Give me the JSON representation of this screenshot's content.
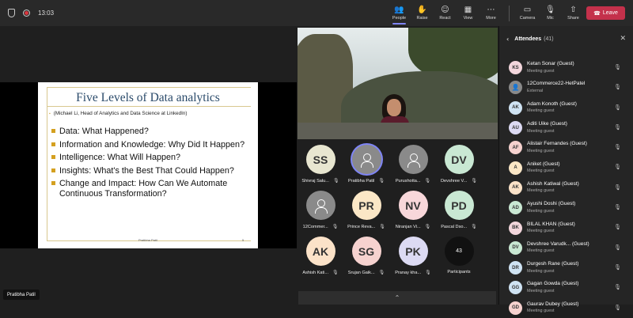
{
  "topbar": {
    "time": "13:03",
    "actions": [
      {
        "icon": "people-icon",
        "glyph": "👥",
        "label": "People",
        "active": true
      },
      {
        "icon": "raise-hand-icon",
        "glyph": "✋",
        "label": "Raise",
        "active": false
      },
      {
        "icon": "react-icon",
        "glyph": "☺",
        "label": "React",
        "active": false
      },
      {
        "icon": "view-icon",
        "glyph": "▦",
        "label": "View",
        "active": false
      },
      {
        "icon": "more-icon",
        "glyph": "⋯",
        "label": "More",
        "active": false
      }
    ],
    "devices": [
      {
        "icon": "camera-off-icon",
        "glyph": "▭",
        "label": "Camera"
      },
      {
        "icon": "mic-off-icon",
        "glyph": "🎙",
        "label": "Mic"
      },
      {
        "icon": "share-icon",
        "glyph": "⇧",
        "label": "Share"
      }
    ],
    "leave_label": "Leave",
    "leave_color": "#c4314b"
  },
  "slide": {
    "title": "Five Levels of Data analytics",
    "subtitle": "(Michael Li, Head of Analytics and Data Science at LinkedIn)",
    "bullets": [
      "Data: What Happened?",
      "Information and Knowledge: Why Did It Happen?",
      "Intelligence: What Will Happen?",
      "Insights: What's the Best That Could Happen?",
      "Change and Impact: How Can We Automate Continuous Transformation?"
    ],
    "footer_name": "Pratibha Patil",
    "footer_page": "5"
  },
  "presenter_name": "Pratibha Patil",
  "tiles": [
    {
      "initials": "SS",
      "name": "Shivraj Salu...",
      "color": "#e8e6d0",
      "type": "initials"
    },
    {
      "initials": "",
      "name": "Pratibha Patil",
      "color": "#8a8a8a",
      "type": "person",
      "speaking": true
    },
    {
      "initials": "",
      "name": "Purushotta...",
      "color": "#8a8a8a",
      "type": "person"
    },
    {
      "initials": "DV",
      "name": "Devshree V...",
      "color": "#c9e8d3",
      "type": "initials"
    },
    {
      "initials": "",
      "name": "12Commer...",
      "color": "#8a8a8a",
      "type": "person"
    },
    {
      "initials": "PR",
      "name": "Prince Reva...",
      "color": "#fbe7c6",
      "type": "initials"
    },
    {
      "initials": "NV",
      "name": "Niranjan Vi...",
      "color": "#f8d7da",
      "type": "initials"
    },
    {
      "initials": "PD",
      "name": "Pascal Dso...",
      "color": "#c9e8d3",
      "type": "initials"
    },
    {
      "initials": "AK",
      "name": "Ashish Kati...",
      "color": "#fbe2c8",
      "type": "initials"
    },
    {
      "initials": "SG",
      "name": "Srujan Gaik...",
      "color": "#f6d2cf",
      "type": "initials"
    },
    {
      "initials": "PK",
      "name": "Pranay kha...",
      "color": "#dcdaf3",
      "type": "initials"
    },
    {
      "initials": "43",
      "name": "Participants",
      "color": "#111111",
      "type": "count"
    }
  ],
  "panel": {
    "title": "Attendees",
    "count": "(41)",
    "attendees": [
      {
        "initials": "KS",
        "name": "Ketan Sonar (Guest)",
        "role": "Meeting guest",
        "color": "#f3d6dc"
      },
      {
        "initials": "",
        "name": "12Commerce22-HetPatel",
        "role": "External",
        "color": "#8a8a8a"
      },
      {
        "initials": "AK",
        "name": "Adam Konoth (Guest)",
        "role": "Meeting guest",
        "color": "#cfe3f3"
      },
      {
        "initials": "AU",
        "name": "Aditi Uike (Guest)",
        "role": "Meeting guest",
        "color": "#dcdaf3"
      },
      {
        "initials": "AF",
        "name": "Alistair Fernandes (Guest)",
        "role": "Meeting guest",
        "color": "#f6d2cf"
      },
      {
        "initials": "A",
        "name": "Aniket (Guest)",
        "role": "Meeting guest",
        "color": "#fbe7c6"
      },
      {
        "initials": "AK",
        "name": "Ashish Katiwal (Guest)",
        "role": "Meeting guest",
        "color": "#fbe2c8"
      },
      {
        "initials": "AD",
        "name": "Ayushi Doshi (Guest)",
        "role": "Meeting guest",
        "color": "#c9e8d3"
      },
      {
        "initials": "BK",
        "name": "BILAL KHAN (Guest)",
        "role": "Meeting guest",
        "color": "#f3d6dc"
      },
      {
        "initials": "DV",
        "name": "Devshree Varudk... (Guest)",
        "role": "Meeting guest",
        "color": "#c9e8d3"
      },
      {
        "initials": "DR",
        "name": "Durgesh Rane (Guest)",
        "role": "Meeting guest",
        "color": "#cfe3f3"
      },
      {
        "initials": "GG",
        "name": "Gagan Gowda (Guest)",
        "role": "Meeting guest",
        "color": "#cfe3f3"
      },
      {
        "initials": "GD",
        "name": "Gaurav Dubey (Guest)",
        "role": "Meeting guest",
        "color": "#f6d2cf"
      }
    ]
  },
  "scroll_icon": "chevron-up-icon"
}
